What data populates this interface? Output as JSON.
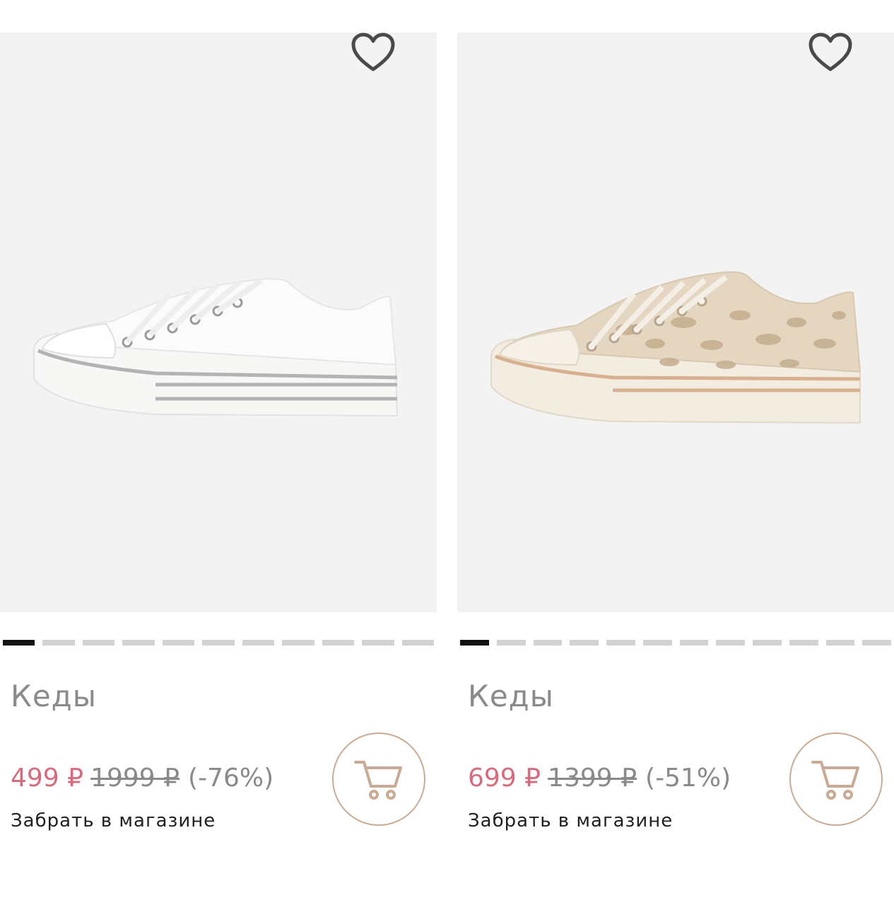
{
  "products": [
    {
      "title": "Кеды",
      "price_new": "499 ₽",
      "price_old": "1999 ₽",
      "discount": "(-76%)",
      "pickup": "Забрать в магазине",
      "slides_total": 11,
      "slide_active_index": 0,
      "image": "white-sneaker"
    },
    {
      "title": "Кеды",
      "price_new": "699 ₽",
      "price_old": "1399 ₽",
      "discount": "(-51%)",
      "pickup": "Забрать в магазине",
      "slides_total": 12,
      "slide_active_index": 0,
      "image": "leopard-sneaker"
    }
  ],
  "icons": {
    "favorite": "heart-icon",
    "cart": "cart-icon"
  },
  "colors": {
    "price_new": "#d86a7d",
    "price_old": "#8a8a8a",
    "cart_border": "#c9ab95",
    "dot_active": "#111111",
    "dot_inactive": "#d2d2d2",
    "photo_bg": "#f3f3f3"
  }
}
